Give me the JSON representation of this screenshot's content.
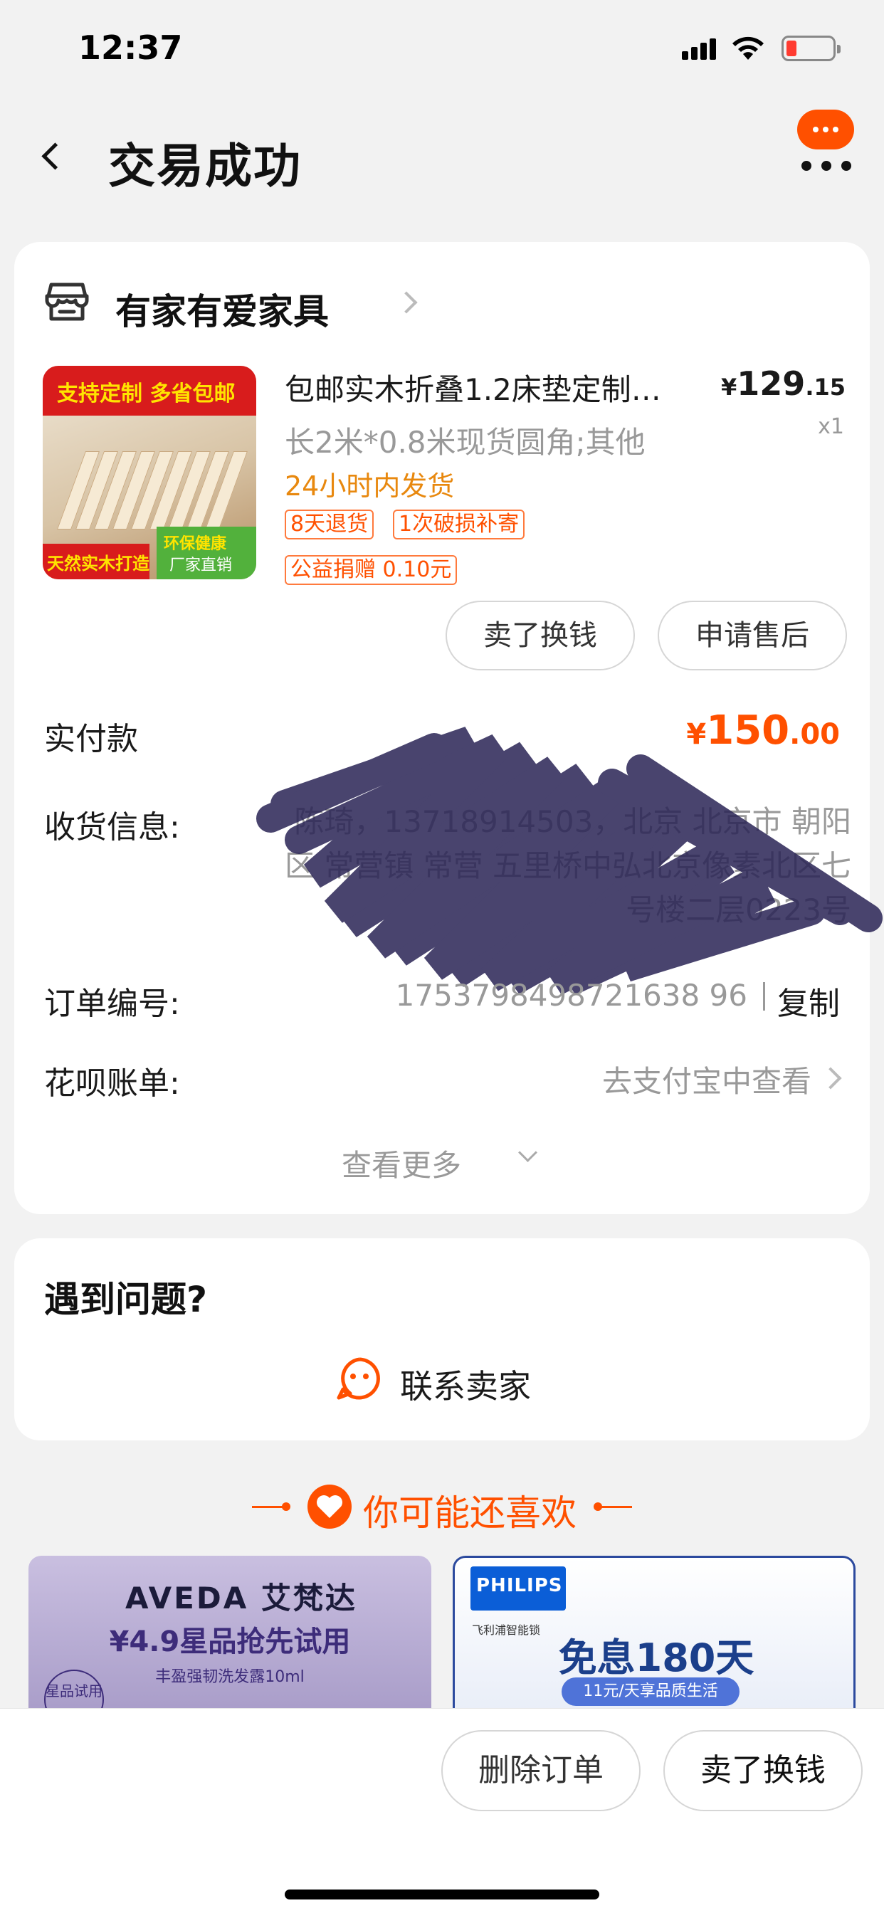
{
  "status_bar": {
    "time": "12:37"
  },
  "nav": {
    "title": "交易成功"
  },
  "shop": {
    "name": "有家有爱家具"
  },
  "product": {
    "image_banner_top": "支持定制 多省包邮",
    "image_text_left": "天然实木打造",
    "image_text_right_1": "环保健康",
    "image_text_right_2": "厂家直销",
    "title": "包邮实木折叠1.2床垫定制…",
    "price_currency": "¥",
    "price_int": "129",
    "price_dec": ".15",
    "quantity": "x1",
    "sku": "长2米*0.8米现货圆角;其他",
    "ship_time": "24小时内发货",
    "tags": [
      "8天退货",
      "1次破损补寄",
      "公益捐赠 0.10元"
    ]
  },
  "actions": {
    "sell": "卖了换钱",
    "after_sale": "申请售后"
  },
  "payment": {
    "label": "实付款",
    "currency": "¥",
    "int": "150",
    "dec": ".00"
  },
  "address": {
    "label": "收货信息:",
    "value": "陈琦，13718914503，北京 北京市 朝阳区 常营镇 常营 五里桥中弘北京像素北区七号楼二层0223号"
  },
  "order": {
    "label": "订单编号:",
    "number": "1753798498721638 96",
    "copy": "复制"
  },
  "huabei": {
    "label": "花呗账单:",
    "value": "去支付宝中查看"
  },
  "see_more": "查看更多",
  "help": {
    "title": "遇到问题?",
    "contact": "联系卖家"
  },
  "recommend": {
    "title": "你可能还喜欢",
    "items": [
      {
        "brand": "AVEDA 艾梵达",
        "promo": "¥4.9星品抢先试用",
        "sub": "丰盈强韧洗发露10ml",
        "badge": "星品试用"
      },
      {
        "brand": "PHILIPS",
        "brand_sub": "飞利浦智能锁",
        "promo": "免息180天",
        "chip": "11元/天享品质生活"
      }
    ]
  },
  "bottom": {
    "delete": "删除订单",
    "sell": "卖了换钱"
  },
  "colors": {
    "accent": "#ff5000",
    "orange_text": "#e8880e",
    "muted": "#999999"
  }
}
